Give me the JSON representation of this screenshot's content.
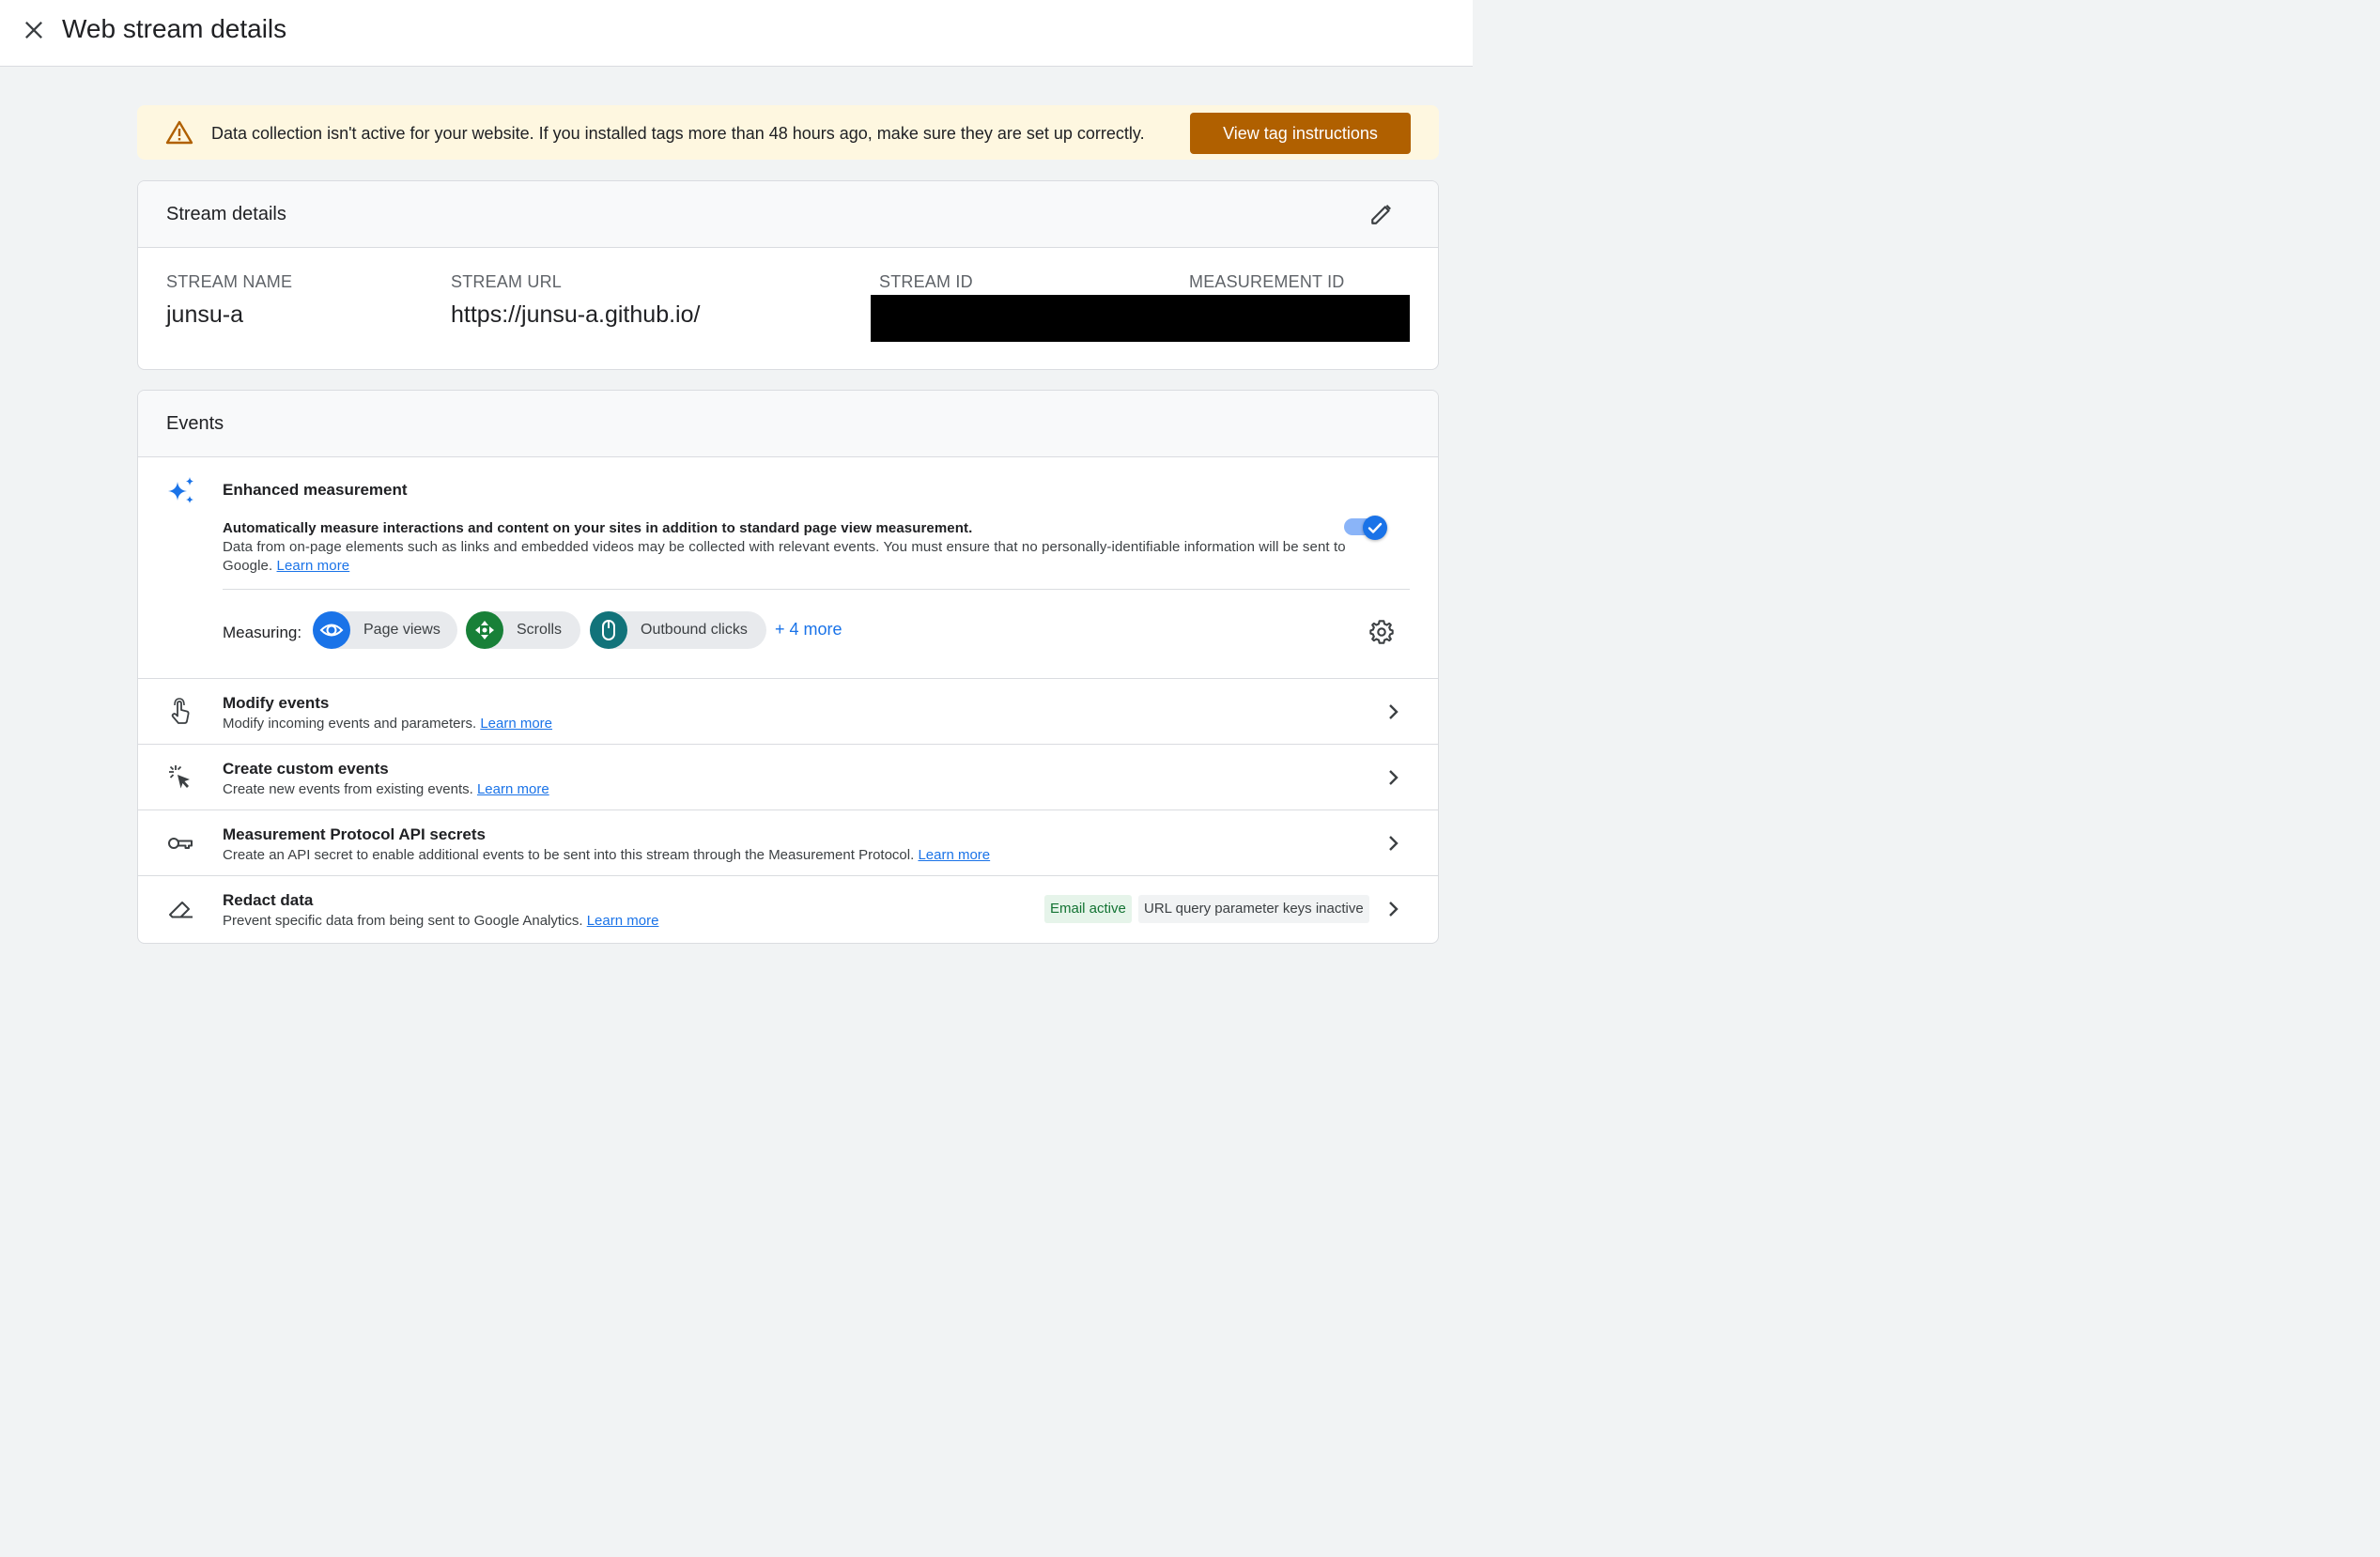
{
  "header": {
    "title": "Web stream details",
    "close_icon": "close-icon"
  },
  "banner": {
    "icon": "warning-icon",
    "text": "Data collection isn't active for your website. If you installed tags more than 48 hours ago, make sure they are set up correctly.",
    "button_label": "View tag instructions",
    "button_color": "#b06000"
  },
  "stream_details": {
    "title": "Stream details",
    "edit_icon": "pencil-icon",
    "columns": [
      {
        "label": "STREAM NAME",
        "value": "junsu-a"
      },
      {
        "label": "STREAM URL",
        "value": "https://junsu-a.github.io/"
      },
      {
        "label": "STREAM ID",
        "value": ""
      },
      {
        "label": "MEASUREMENT ID",
        "value": ""
      }
    ]
  },
  "events": {
    "title": "Events",
    "enhanced": {
      "icon": "sparkle-icon",
      "title": "Enhanced measurement",
      "desc_bold": "Automatically measure interactions and content on your sites in addition to standard page view measurement.",
      "desc": "Data from on-page elements such as links and embedded videos may be collected with relevant events. You must ensure that no personally-identifiable information will be sent to Google.",
      "learn_more": "Learn more",
      "toggle_on": true,
      "measuring_label": "Measuring:",
      "chips": [
        {
          "label": "Page views",
          "icon": "eye-icon",
          "color": "#1a73e8"
        },
        {
          "label": "Scrolls",
          "icon": "scroll-arrows-icon",
          "color": "#188038"
        },
        {
          "label": "Outbound clicks",
          "icon": "mouse-icon",
          "color": "#12737a"
        }
      ],
      "more_label": "+ 4 more",
      "settings_icon": "gear-icon"
    },
    "rows": [
      {
        "icon": "touch-icon",
        "title": "Modify events",
        "subtitle": "Modify incoming events and parameters.",
        "learn_more": "Learn more"
      },
      {
        "icon": "click-sparkle-icon",
        "title": "Create custom events",
        "subtitle": "Create new events from existing events.",
        "learn_more": "Learn more"
      },
      {
        "icon": "key-icon",
        "title": "Measurement Protocol API secrets",
        "subtitle": "Create an API secret to enable additional events to be sent into this stream through the Measurement Protocol.",
        "learn_more": "Learn more"
      },
      {
        "icon": "eraser-icon",
        "title": "Redact data",
        "subtitle": "Prevent specific data from being sent to Google Analytics.",
        "learn_more": "Learn more",
        "badges": [
          "Email active",
          "URL query parameter keys inactive"
        ]
      }
    ]
  }
}
